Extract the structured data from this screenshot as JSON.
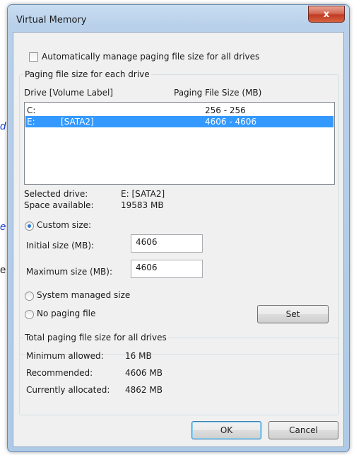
{
  "background": {
    "fragments": [
      "d",
      "e",
      "e"
    ]
  },
  "window": {
    "title": "Virtual Memory",
    "close_glyph": "x"
  },
  "auto_manage": {
    "label": "Automatically manage paging file size for all drives",
    "checked": false
  },
  "drives_group": {
    "title": "Paging file size for each drive",
    "columns": [
      "Drive  [Volume Label]",
      "Paging File Size (MB)"
    ],
    "rows": [
      {
        "drive": "C:",
        "label": "",
        "size": "256 - 256",
        "selected": false
      },
      {
        "drive": "E:",
        "label": "[SATA2]",
        "size": "4606 - 4606",
        "selected": true
      }
    ],
    "selected_drive_label": "Selected drive:",
    "selected_drive_value": "E:  [SATA2]",
    "space_available_label": "Space available:",
    "space_available_value": "19583 MB",
    "custom_size_label": "Custom size:",
    "initial_size_label": "Initial size (MB):",
    "initial_size_value": "4606",
    "maximum_size_label": "Maximum size (MB):",
    "maximum_size_value": "4606",
    "system_managed_label": "System managed size",
    "no_paging_label": "No paging file",
    "selected_option": "custom",
    "set_button": "Set"
  },
  "totals_group": {
    "title": "Total paging file size for all drives",
    "minimum_label": "Minimum allowed:",
    "minimum_value": "16 MB",
    "recommended_label": "Recommended:",
    "recommended_value": "4606 MB",
    "allocated_label": "Currently allocated:",
    "allocated_value": "4862 MB"
  },
  "buttons": {
    "ok": "OK",
    "cancel": "Cancel"
  },
  "colors": {
    "selection": "#3399ff",
    "close_button": "#c94a33",
    "link_blue": "#1a3fd6"
  }
}
